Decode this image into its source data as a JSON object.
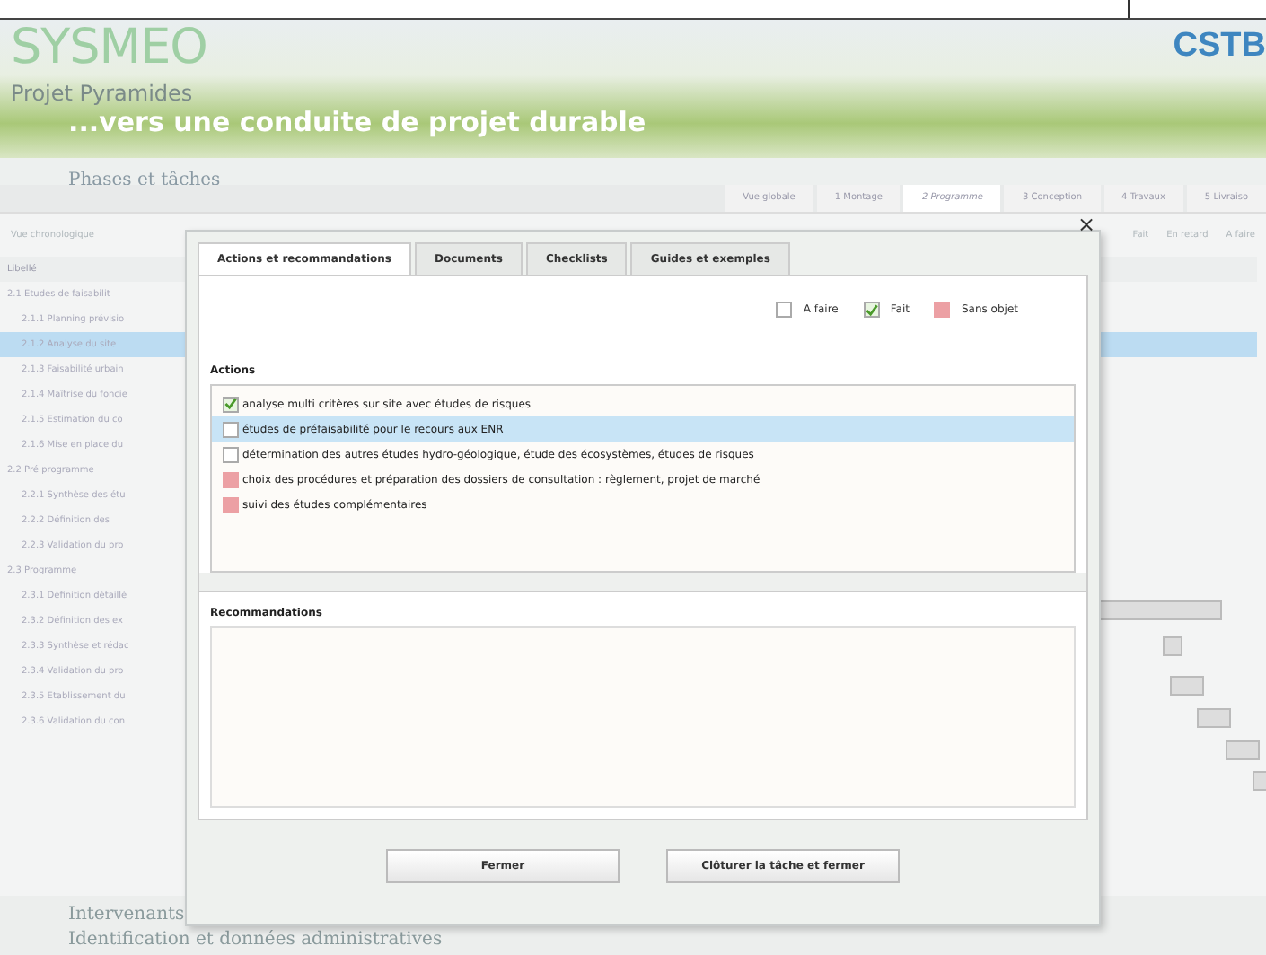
{
  "header": {
    "logo": "SYSMEO",
    "partner_logo": "CSTB",
    "project": "Projet  Pyramides",
    "tagline": "...vers une conduite de projet durable"
  },
  "section_title": "Phases et tâches",
  "phase_tabs": [
    {
      "label": "Vue globale",
      "selected": false
    },
    {
      "label": "1 Montage",
      "selected": false
    },
    {
      "label": "2 Programme",
      "selected": true
    },
    {
      "label": "3 Conception",
      "selected": false
    },
    {
      "label": "4 Travaux",
      "selected": false
    },
    {
      "label": "5 Livraiso",
      "selected": false
    }
  ],
  "view_label": "Vue chronologique",
  "background_legend": [
    "Fait",
    "En retard",
    "A faire"
  ],
  "task_list": {
    "heading": "Libellé",
    "items": [
      {
        "label": "2.1 Etudes de faisabilit",
        "selected": false,
        "children": [
          {
            "label": "2.1.1 Planning prévisio",
            "selected": false
          },
          {
            "label": "2.1.2 Analyse du site",
            "selected": true
          },
          {
            "label": "2.1.3 Faisabilité urbain",
            "selected": false
          },
          {
            "label": "2.1.4 Maîtrise du foncie",
            "selected": false
          },
          {
            "label": "2.1.5 Estimation du co",
            "selected": false
          },
          {
            "label": "2.1.6 Mise en place du",
            "selected": false
          }
        ]
      },
      {
        "label": "2.2 Pré programme",
        "selected": false,
        "children": [
          {
            "label": "2.2.1 Synthèse des étu",
            "selected": false
          },
          {
            "label": "2.2.2 Définition des",
            "selected": false
          },
          {
            "label": "2.2.3 Validation du pro",
            "selected": false
          }
        ]
      },
      {
        "label": "2.3 Programme",
        "selected": false,
        "children": [
          {
            "label": "2.3.1 Définition détaillé",
            "selected": false
          },
          {
            "label": "2.3.2 Définition des ex",
            "selected": false
          },
          {
            "label": "2.3.3 Synthèse et rédac",
            "selected": false
          },
          {
            "label": "2.3.4 Validation du pro",
            "selected": false
          },
          {
            "label": "2.3.5 Etablissement du",
            "selected": false
          },
          {
            "label": "2.3.6 Validation du con",
            "selected": false
          }
        ]
      }
    ]
  },
  "footer_sections": [
    "Intervenants",
    "Identification et données administratives"
  ],
  "dialog": {
    "close": "×",
    "tabs": [
      {
        "label": "Actions et recommandations",
        "selected": true
      },
      {
        "label": "Documents",
        "selected": false
      },
      {
        "label": "Checklists",
        "selected": false
      },
      {
        "label": "Guides et exemples",
        "selected": false
      }
    ],
    "legend": [
      {
        "label": "A faire",
        "kind": "todo"
      },
      {
        "label": "Fait",
        "kind": "done"
      },
      {
        "label": "Sans objet",
        "kind": "na"
      }
    ],
    "actions_title": "Actions",
    "actions": [
      {
        "text": "analyse multi critères sur site avec études de risques",
        "kind": "done",
        "selected": false
      },
      {
        "text": "études de préfaisabilité pour le recours aux ENR",
        "kind": "todo",
        "selected": true
      },
      {
        "text": "détermination des autres études hydro-géologique, étude des écosystèmes, études de risques",
        "kind": "todo",
        "selected": false
      },
      {
        "text": "choix des procédures et préparation des dossiers de consultation : règlement, projet de marché",
        "kind": "na",
        "selected": false
      },
      {
        "text": "suivi des études complémentaires",
        "kind": "na",
        "selected": false
      }
    ],
    "recommendations_title": "Recommandations",
    "buttons": [
      "Fermer",
      "Clôturer la tâche et fermer"
    ]
  }
}
